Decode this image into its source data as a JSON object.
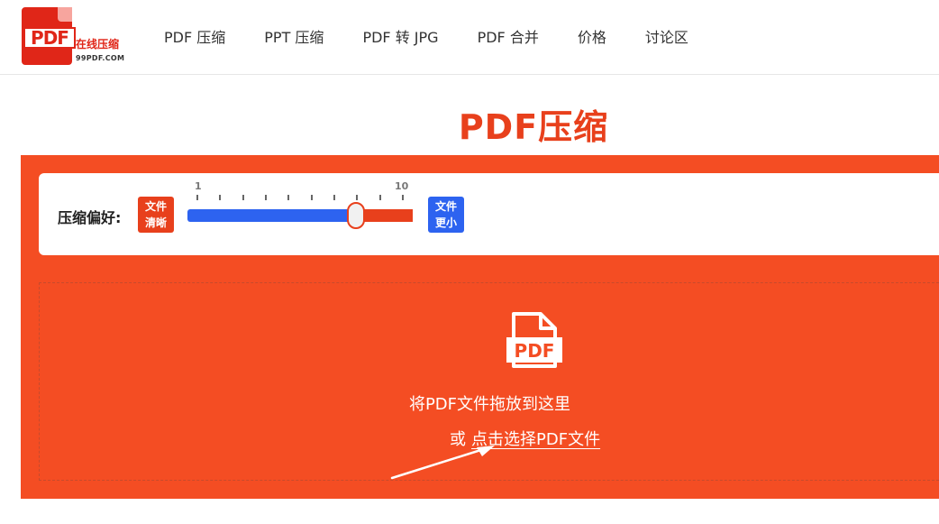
{
  "logo": {
    "mark_text": "PDF",
    "name": "在线压缩",
    "domain": "99PDF.COM",
    "brand_color": "#e02618"
  },
  "nav": {
    "items": [
      {
        "label": "PDF 压缩"
      },
      {
        "label": "PPT 压缩"
      },
      {
        "label": "PDF 转 JPG"
      },
      {
        "label": "PDF 合并"
      },
      {
        "label": "价格"
      },
      {
        "label": "讨论区"
      }
    ]
  },
  "page_title": "PDF压缩",
  "compression": {
    "label": "压缩偏好:",
    "badge_clear": {
      "line1": "文件",
      "line2": "清晰",
      "color": "#e8401c"
    },
    "badge_small": {
      "line1": "文件",
      "line2": "更小",
      "color": "#2d63f0"
    },
    "scale_min": "1",
    "scale_max": "10",
    "value": 8,
    "fill_color": "#2d63f0",
    "rest_color": "#e8401c"
  },
  "dropzone": {
    "icon": "pdf-file-icon",
    "icon_text": "PDF",
    "drop_text": "将PDF文件拖放到这里",
    "or_text": "或",
    "choose_text": "点击选择PDF文件",
    "background": "#f44d23"
  }
}
